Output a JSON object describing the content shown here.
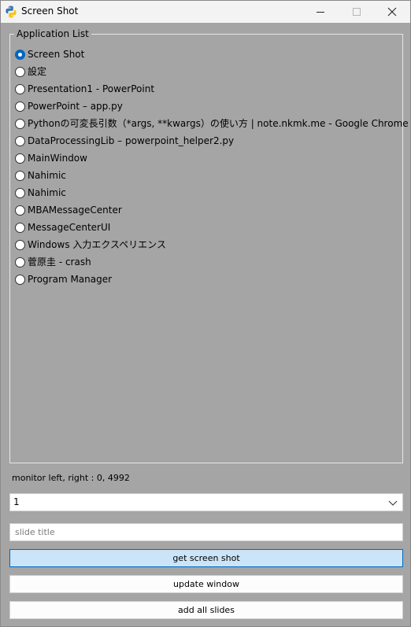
{
  "window": {
    "title": "Screen Shot"
  },
  "application_list": {
    "label": "Application List",
    "items": [
      {
        "label": "Screen Shot",
        "checked": true
      },
      {
        "label": "設定",
        "checked": false
      },
      {
        "label": "Presentation1 - PowerPoint",
        "checked": false
      },
      {
        "label": "PowerPoint – app.py",
        "checked": false
      },
      {
        "label": "Pythonの可変長引数（*args, **kwargs）の使い方 | note.nkmk.me - Google Chrome",
        "checked": false
      },
      {
        "label": "DataProcessingLib – powerpoint_helper2.py",
        "checked": false
      },
      {
        "label": "MainWindow",
        "checked": false
      },
      {
        "label": "Nahimic",
        "checked": false
      },
      {
        "label": "Nahimic",
        "checked": false
      },
      {
        "label": "MBAMessageCenter",
        "checked": false
      },
      {
        "label": "MessageCenterUI",
        "checked": false
      },
      {
        "label": "Windows 入力エクスペリエンス",
        "checked": false
      },
      {
        "label": "菅原圭 - crash",
        "checked": false
      },
      {
        "label": "Program Manager",
        "checked": false
      }
    ]
  },
  "monitor": {
    "label": "monitor left, right : 0, 4992"
  },
  "monitor_select": {
    "value": "1"
  },
  "slide_title": {
    "value": "",
    "placeholder": "slide title"
  },
  "buttons": {
    "get_screen_shot": "get screen shot",
    "update_window": "update window",
    "add_all_slides": "add all slides"
  },
  "colors": {
    "window_bg": "#a5a5a5",
    "accent": "#0067c0",
    "primary_button_bg": "#cce4f7"
  }
}
